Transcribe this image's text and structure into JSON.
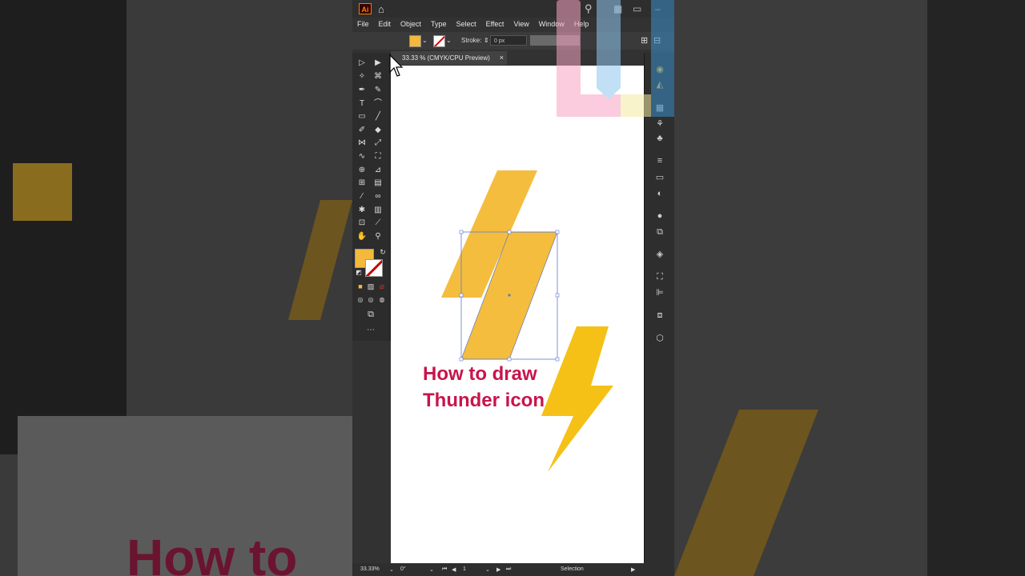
{
  "menu": [
    "File",
    "Edit",
    "Object",
    "Type",
    "Select",
    "Effect",
    "View",
    "Window",
    "Help"
  ],
  "control": {
    "stroke_label": "Stroke:",
    "stroke_value": "0 px"
  },
  "document": {
    "tab_title": "33.33 % (CMYK/CPU Preview)",
    "close": "×"
  },
  "canvas": {
    "title_line1": "How to draw",
    "title_line2": "Thunder icon"
  },
  "status": {
    "zoom": "33.33%",
    "rotation": "0°",
    "artboard": "1",
    "tool": "Selection"
  },
  "colors": {
    "fill": "#f4b93c",
    "accent_text": "#c8144c",
    "bolt": "#f5c117"
  },
  "background_text": "How to"
}
